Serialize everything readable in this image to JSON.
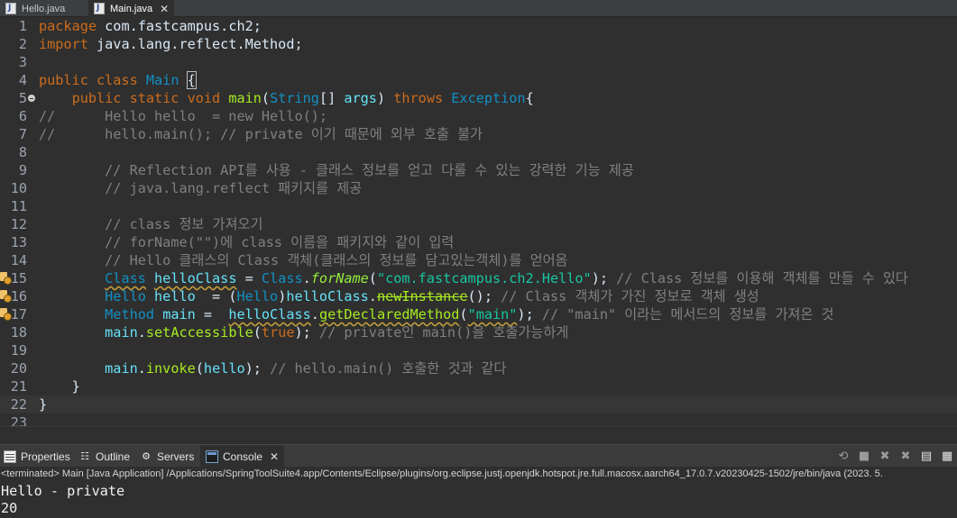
{
  "editor_tabs": [
    {
      "label": "Hello.java",
      "active": false
    },
    {
      "label": "Main.java",
      "active": true
    }
  ],
  "code_lines": [
    {
      "n": "1",
      "segs": [
        [
          "package",
          "kw"
        ],
        [
          " com.fastcampus.ch2;",
          ""
        ]
      ]
    },
    {
      "n": "2",
      "segs": [
        [
          "import",
          "kw"
        ],
        [
          " java.lang.reflect.Method;",
          ""
        ]
      ]
    },
    {
      "n": "3",
      "segs": []
    },
    {
      "n": "4",
      "segs": [
        [
          "public class",
          "kw"
        ],
        [
          " ",
          ""
        ],
        [
          "Main",
          "typ"
        ],
        [
          " ",
          ""
        ],
        [
          "{",
          "bm"
        ]
      ]
    },
    {
      "n": "5",
      "fold": true,
      "segs": [
        [
          "    ",
          ""
        ],
        [
          "public static void",
          "kw"
        ],
        [
          " ",
          ""
        ],
        [
          "main",
          "mth"
        ],
        [
          "(",
          ""
        ],
        [
          "String",
          "typ"
        ],
        [
          "[] ",
          ""
        ],
        [
          "args",
          "fld"
        ],
        [
          ") ",
          ""
        ],
        [
          "throws",
          "kw"
        ],
        [
          " ",
          ""
        ],
        [
          "Exception",
          "typ"
        ],
        [
          "{",
          ""
        ]
      ]
    },
    {
      "n": "6",
      "segs": [
        [
          "//      Hello hello  = new Hello();",
          "cmt"
        ]
      ]
    },
    {
      "n": "7",
      "segs": [
        [
          "//      hello.main(); // private 이기 때문에 외부 호출 불가",
          "cmt"
        ]
      ]
    },
    {
      "n": "8",
      "segs": []
    },
    {
      "n": "9",
      "segs": [
        [
          "        // Reflection API를 사용 - 클래스 정보를 얻고 다룰 수 있는 강력한 기능 제공",
          "cmt"
        ]
      ]
    },
    {
      "n": "10",
      "segs": [
        [
          "        // java.lang.reflect 패키지를 제공",
          "cmt"
        ]
      ]
    },
    {
      "n": "11",
      "segs": []
    },
    {
      "n": "12",
      "segs": [
        [
          "        // class 정보 가져오기",
          "cmt"
        ]
      ]
    },
    {
      "n": "13",
      "segs": [
        [
          "        // forName(\"\")에 class 이름을 패키지와 같이 입력",
          "cmt"
        ]
      ]
    },
    {
      "n": "14",
      "segs": [
        [
          "        // Hello 클래스의 Class 객체(클래스의 정보를 담고있는객체)를 얻어옴",
          "cmt"
        ]
      ]
    },
    {
      "n": "15",
      "warn": true,
      "segs": [
        [
          "        ",
          ""
        ],
        [
          "Class",
          "typ wv"
        ],
        [
          " ",
          ""
        ],
        [
          "helloClass",
          "fld wv"
        ],
        [
          " = ",
          ""
        ],
        [
          "Class",
          "typ"
        ],
        [
          ".",
          ""
        ],
        [
          "forName",
          "smth"
        ],
        [
          "(",
          ""
        ],
        [
          "\"com.fastcampus.ch2.Hello\"",
          "str"
        ],
        [
          "); ",
          ""
        ],
        [
          "// Class 정보를 이용해 객체를 만들 수 있다",
          "cmt"
        ]
      ]
    },
    {
      "n": "16",
      "warn": true,
      "segs": [
        [
          "        ",
          ""
        ],
        [
          "Hello",
          "typ"
        ],
        [
          " ",
          ""
        ],
        [
          "hello",
          "fld"
        ],
        [
          "  = (",
          ""
        ],
        [
          "Hello",
          "typ"
        ],
        [
          ")",
          ""
        ],
        [
          "helloClass",
          "fld"
        ],
        [
          ".",
          ""
        ],
        [
          "newInstance",
          "mth dep"
        ],
        [
          "(); ",
          ""
        ],
        [
          "// Class 객체가 가진 정보로 객체 생성",
          "cmt"
        ]
      ]
    },
    {
      "n": "17",
      "warn": true,
      "segs": [
        [
          "        ",
          ""
        ],
        [
          "Method",
          "typ"
        ],
        [
          " ",
          ""
        ],
        [
          "main",
          "fld"
        ],
        [
          " =  ",
          ""
        ],
        [
          "helloClass",
          "fld wv"
        ],
        [
          ".",
          ""
        ],
        [
          "getDeclaredMethod",
          "mth wv"
        ],
        [
          "(",
          ""
        ],
        [
          "\"main\"",
          "str wv"
        ],
        [
          "); ",
          ""
        ],
        [
          "// \"main\" 이라는 메서드의 정보를 가져온 것",
          "cmt"
        ]
      ]
    },
    {
      "n": "18",
      "segs": [
        [
          "        ",
          ""
        ],
        [
          "main",
          "fld"
        ],
        [
          ".",
          ""
        ],
        [
          "setAccessible",
          "mth"
        ],
        [
          "(",
          ""
        ],
        [
          "true",
          "kw"
        ],
        [
          "); ",
          ""
        ],
        [
          "// private인 main()을 호출가능하게",
          "cmt"
        ]
      ]
    },
    {
      "n": "19",
      "segs": []
    },
    {
      "n": "20",
      "segs": [
        [
          "        ",
          ""
        ],
        [
          "main",
          "fld"
        ],
        [
          ".",
          ""
        ],
        [
          "invoke",
          "mth"
        ],
        [
          "(",
          ""
        ],
        [
          "hello",
          "fld"
        ],
        [
          "); ",
          ""
        ],
        [
          "// hello.main() 호출한 것과 같다",
          "cmt"
        ]
      ]
    },
    {
      "n": "21",
      "segs": [
        [
          "    }",
          ""
        ]
      ]
    },
    {
      "n": "22",
      "current": true,
      "segs": [
        [
          "}",
          ""
        ]
      ]
    },
    {
      "n": "23",
      "segs": []
    }
  ],
  "console_tabs": [
    {
      "label": "Properties",
      "icon": "properties-icon"
    },
    {
      "label": "Outline",
      "icon": "outline-icon"
    },
    {
      "label": "Servers",
      "icon": "servers-icon"
    },
    {
      "label": "Console",
      "icon": "console-icon",
      "active": true
    }
  ],
  "console": {
    "status": "<terminated> Main [Java Application] /Applications/SpringToolSuite4.app/Contents/Eclipse/plugins/org.eclipse.justj.openjdk.hotspot.jre.full.macosx.aarch64_17.0.7.v20230425-1502/jre/bin/java  (2023. 5.",
    "output": [
      "Hello - private",
      "20"
    ]
  },
  "toolbar_icons": [
    "terminate-relaunch-icon",
    "stop-icon",
    "remove-launch-icon",
    "remove-all-terminated-icon",
    "scroll-lock-icon",
    "word-wrap-icon"
  ]
}
